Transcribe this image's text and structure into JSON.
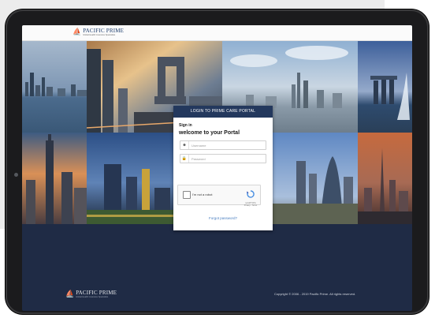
{
  "header": {
    "logo_name": "PACIFIC PRIME",
    "logo_tagline": "Global Health Insurance Specialists"
  },
  "login": {
    "portal_title": "LOGIN TO PRIME CARE PORTAL",
    "signin_label": "Sign in",
    "welcome_text": "welcome to your Portal",
    "username_placeholder": "Username",
    "password_placeholder": "Password",
    "captcha_label": "I'm not a robot",
    "captcha_brand": "reCAPTCHA",
    "captcha_terms": "Privacy - Terms",
    "forgot_link": "Forgot password?"
  },
  "footer": {
    "logo_name": "PACIFIC PRIME",
    "logo_tagline": "Global Health Insurance Specialists",
    "copyright": "Copyright © 2006 - 2019 Pacific Prime. All rights reserved."
  },
  "theme": {
    "navy": "#23385d",
    "footer_bg": "#1f2b45",
    "link": "#4a7fc0",
    "bezel": "#1b1b1d"
  },
  "icons": [
    "user-icon",
    "lock-icon",
    "recaptcha-icon",
    "pacific-prime-logo-icon"
  ]
}
